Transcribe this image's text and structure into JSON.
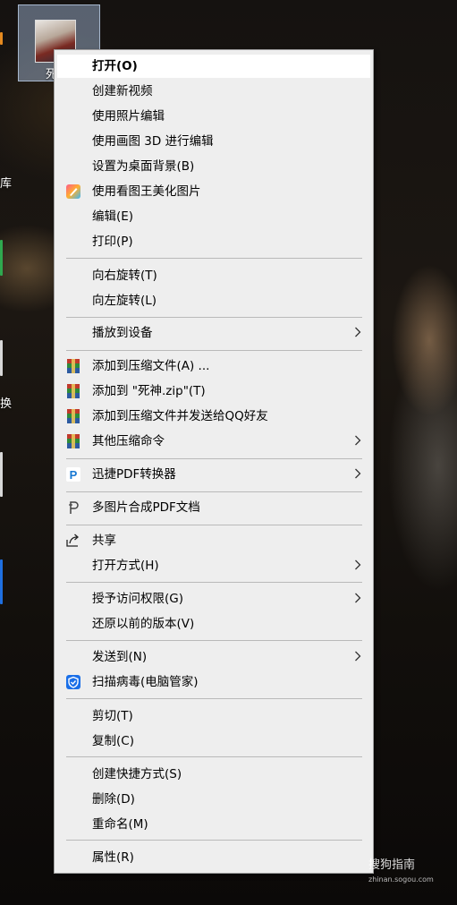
{
  "desktop": {
    "icon_label": "死",
    "edge_labels": [
      "库",
      "换"
    ]
  },
  "menu": {
    "items": [
      {
        "label": "打开(O)",
        "bold": true
      },
      {
        "label": "创建新视频"
      },
      {
        "label": "使用照片编辑"
      },
      {
        "label": "使用画图 3D 进行编辑"
      },
      {
        "label": "设置为桌面背景(B)"
      },
      {
        "label": "使用看图王美化图片",
        "icon": "kantu-icon"
      },
      {
        "label": "编辑(E)"
      },
      {
        "label": "打印(P)"
      },
      {
        "label": "向右旋转(T)"
      },
      {
        "label": "向左旋转(L)"
      },
      {
        "label": "播放到设备",
        "submenu": true
      },
      {
        "label": "添加到压缩文件(A) ...",
        "icon": "winrar-icon"
      },
      {
        "label": "添加到 \"死神.zip\"(T)",
        "icon": "winrar-icon"
      },
      {
        "label": "添加到压缩文件并发送给QQ好友",
        "icon": "winrar-icon"
      },
      {
        "label": "其他压缩命令",
        "icon": "winrar-icon",
        "submenu": true
      },
      {
        "label": "迅捷PDF转换器",
        "icon": "xunjie-pdf-icon",
        "submenu": true
      },
      {
        "label": "多图片合成PDF文档",
        "icon": "pdf-merge-icon"
      },
      {
        "label": "共享",
        "icon": "share-icon"
      },
      {
        "label": "打开方式(H)",
        "submenu": true
      },
      {
        "label": "授予访问权限(G)",
        "submenu": true
      },
      {
        "label": "还原以前的版本(V)"
      },
      {
        "label": "发送到(N)",
        "submenu": true
      },
      {
        "label": "扫描病毒(电脑管家)",
        "icon": "tencent-shield-icon"
      },
      {
        "label": "剪切(T)"
      },
      {
        "label": "复制(C)"
      },
      {
        "label": "创建快捷方式(S)"
      },
      {
        "label": "删除(D)"
      },
      {
        "label": "重命名(M)"
      },
      {
        "label": "属性(R)"
      }
    ]
  },
  "watermark": {
    "brand": "搜狗指南",
    "url": "zhinan.sogou.com"
  },
  "colors": {
    "menu_bg": "#eeeeee",
    "highlight": "#ffffff",
    "separator": "#b9b9b9",
    "tencent_blue": "#1a6fe8",
    "pdf_blue": "#1677d2"
  }
}
